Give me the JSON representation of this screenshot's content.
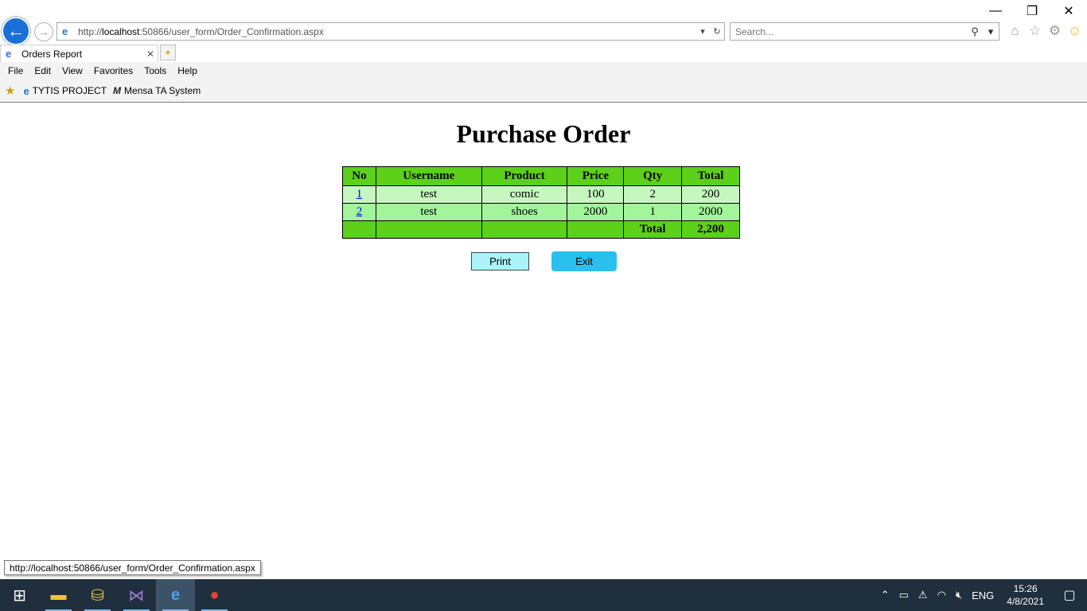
{
  "window": {
    "minimize_glyph": "—",
    "restore_glyph": "❐",
    "close_glyph": "✕"
  },
  "address": {
    "url_prefix": "http://",
    "url_host": "localhost",
    "url_rest": ":50866/user_form/Order_Confirmation.aspx"
  },
  "search": {
    "placeholder": "Search..."
  },
  "tab": {
    "title": "Orders Report"
  },
  "menu": [
    "File",
    "Edit",
    "View",
    "Favorites",
    "Tools",
    "Help"
  ],
  "favorites": [
    {
      "label": "TYTIS PROJECT",
      "icon": "ie-icon"
    },
    {
      "label": "Mensa TA System",
      "icon": "m-icon"
    }
  ],
  "page": {
    "title": "Purchase Order",
    "columns": [
      "No",
      "Username",
      "Product",
      "Price",
      "Qty",
      "Total"
    ],
    "rows": [
      {
        "no": "1",
        "username": "test",
        "product": "comic",
        "price": "100",
        "qty": "2",
        "total": "200"
      },
      {
        "no": "2",
        "username": "test",
        "product": "shoes",
        "price": "2000",
        "qty": "1",
        "total": "2000"
      }
    ],
    "footer": {
      "label": "Total",
      "value": "2,200"
    },
    "print_label": "Print",
    "exit_label": "Exit"
  },
  "status_tip": "http://localhost:50866/user_form/Order_Confirmation.aspx",
  "taskbar": {
    "lang": "ENG",
    "time": "15:26",
    "date": "4/8/2021"
  },
  "colors": {
    "header_green": "#5dd019",
    "row_light": "#c6f7c0",
    "row_mid": "#a3f59c",
    "print_bg": "#aaf3f8",
    "exit_bg": "#29c0ef"
  }
}
